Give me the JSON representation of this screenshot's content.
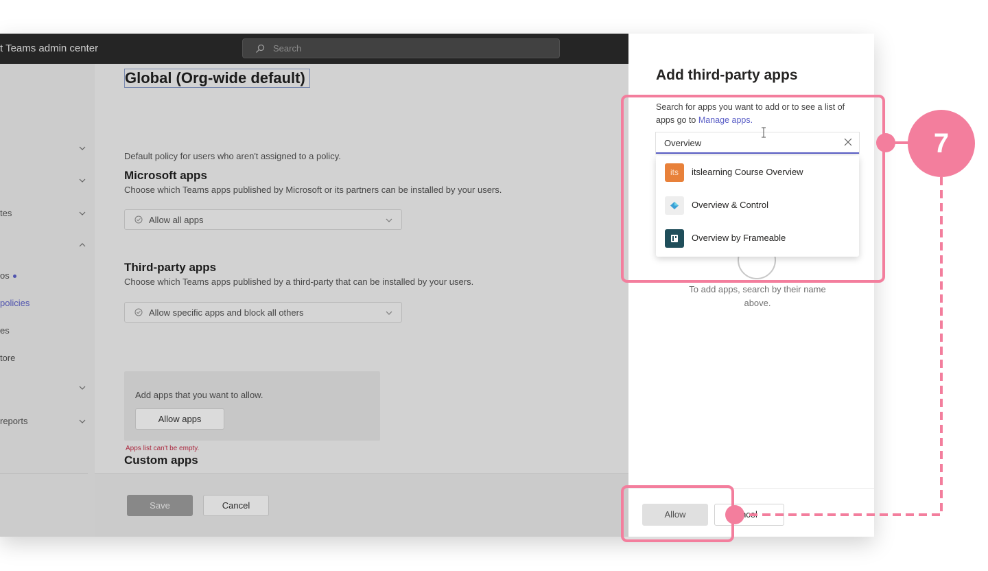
{
  "topbar": {
    "app_title": "t Teams admin center",
    "search_placeholder": "Search"
  },
  "sidebar": {
    "items": [
      {
        "label": ""
      },
      {
        "label": ""
      },
      {
        "label": "tes"
      },
      {
        "label": ""
      },
      {
        "label": "os"
      },
      {
        "label": "policies"
      },
      {
        "label": "es"
      },
      {
        "label": "tore"
      },
      {
        "label": ""
      },
      {
        "label": "reports"
      }
    ]
  },
  "main": {
    "title": "Global (Org-wide default)",
    "description": "Default policy for users who aren't assigned to a policy.",
    "microsoft_apps": {
      "title": "Microsoft apps",
      "description": "Choose which Teams apps published by Microsoft or its partners can be installed by your users.",
      "dropdown_value": "Allow all apps"
    },
    "third_party_apps": {
      "title": "Third-party apps",
      "description": "Choose which Teams apps published by a third-party that can be installed by your users.",
      "dropdown_value": "Allow specific apps and block all others",
      "allow_box_text": "Add apps that you want to allow.",
      "allow_button": "Allow apps",
      "error": "Apps list can't be empty."
    },
    "custom_apps": {
      "title": "Custom apps"
    },
    "footer": {
      "save": "Save",
      "cancel": "Cancel"
    }
  },
  "panel": {
    "title": "Add third-party apps",
    "description_prefix": "Search for apps you want to add or to see a list of apps go to ",
    "description_link": "Manage apps.",
    "search_value": "Overview",
    "results": [
      {
        "label": "itslearning Course Overview",
        "icon": "its",
        "icon_color": "#e8813a"
      },
      {
        "label": "Overview & Control",
        "icon": "overview-control-icon",
        "icon_color": "#eeeeee"
      },
      {
        "label": "Overview by Frameable",
        "icon": "frameable-icon",
        "icon_color": "#1f4e5a"
      }
    ],
    "empty_text": "To add apps, search by their name above.",
    "allow_button": "Allow",
    "cancel_button": "ncel"
  },
  "annotation": {
    "step_number": "7",
    "color": "#f37e9d"
  }
}
